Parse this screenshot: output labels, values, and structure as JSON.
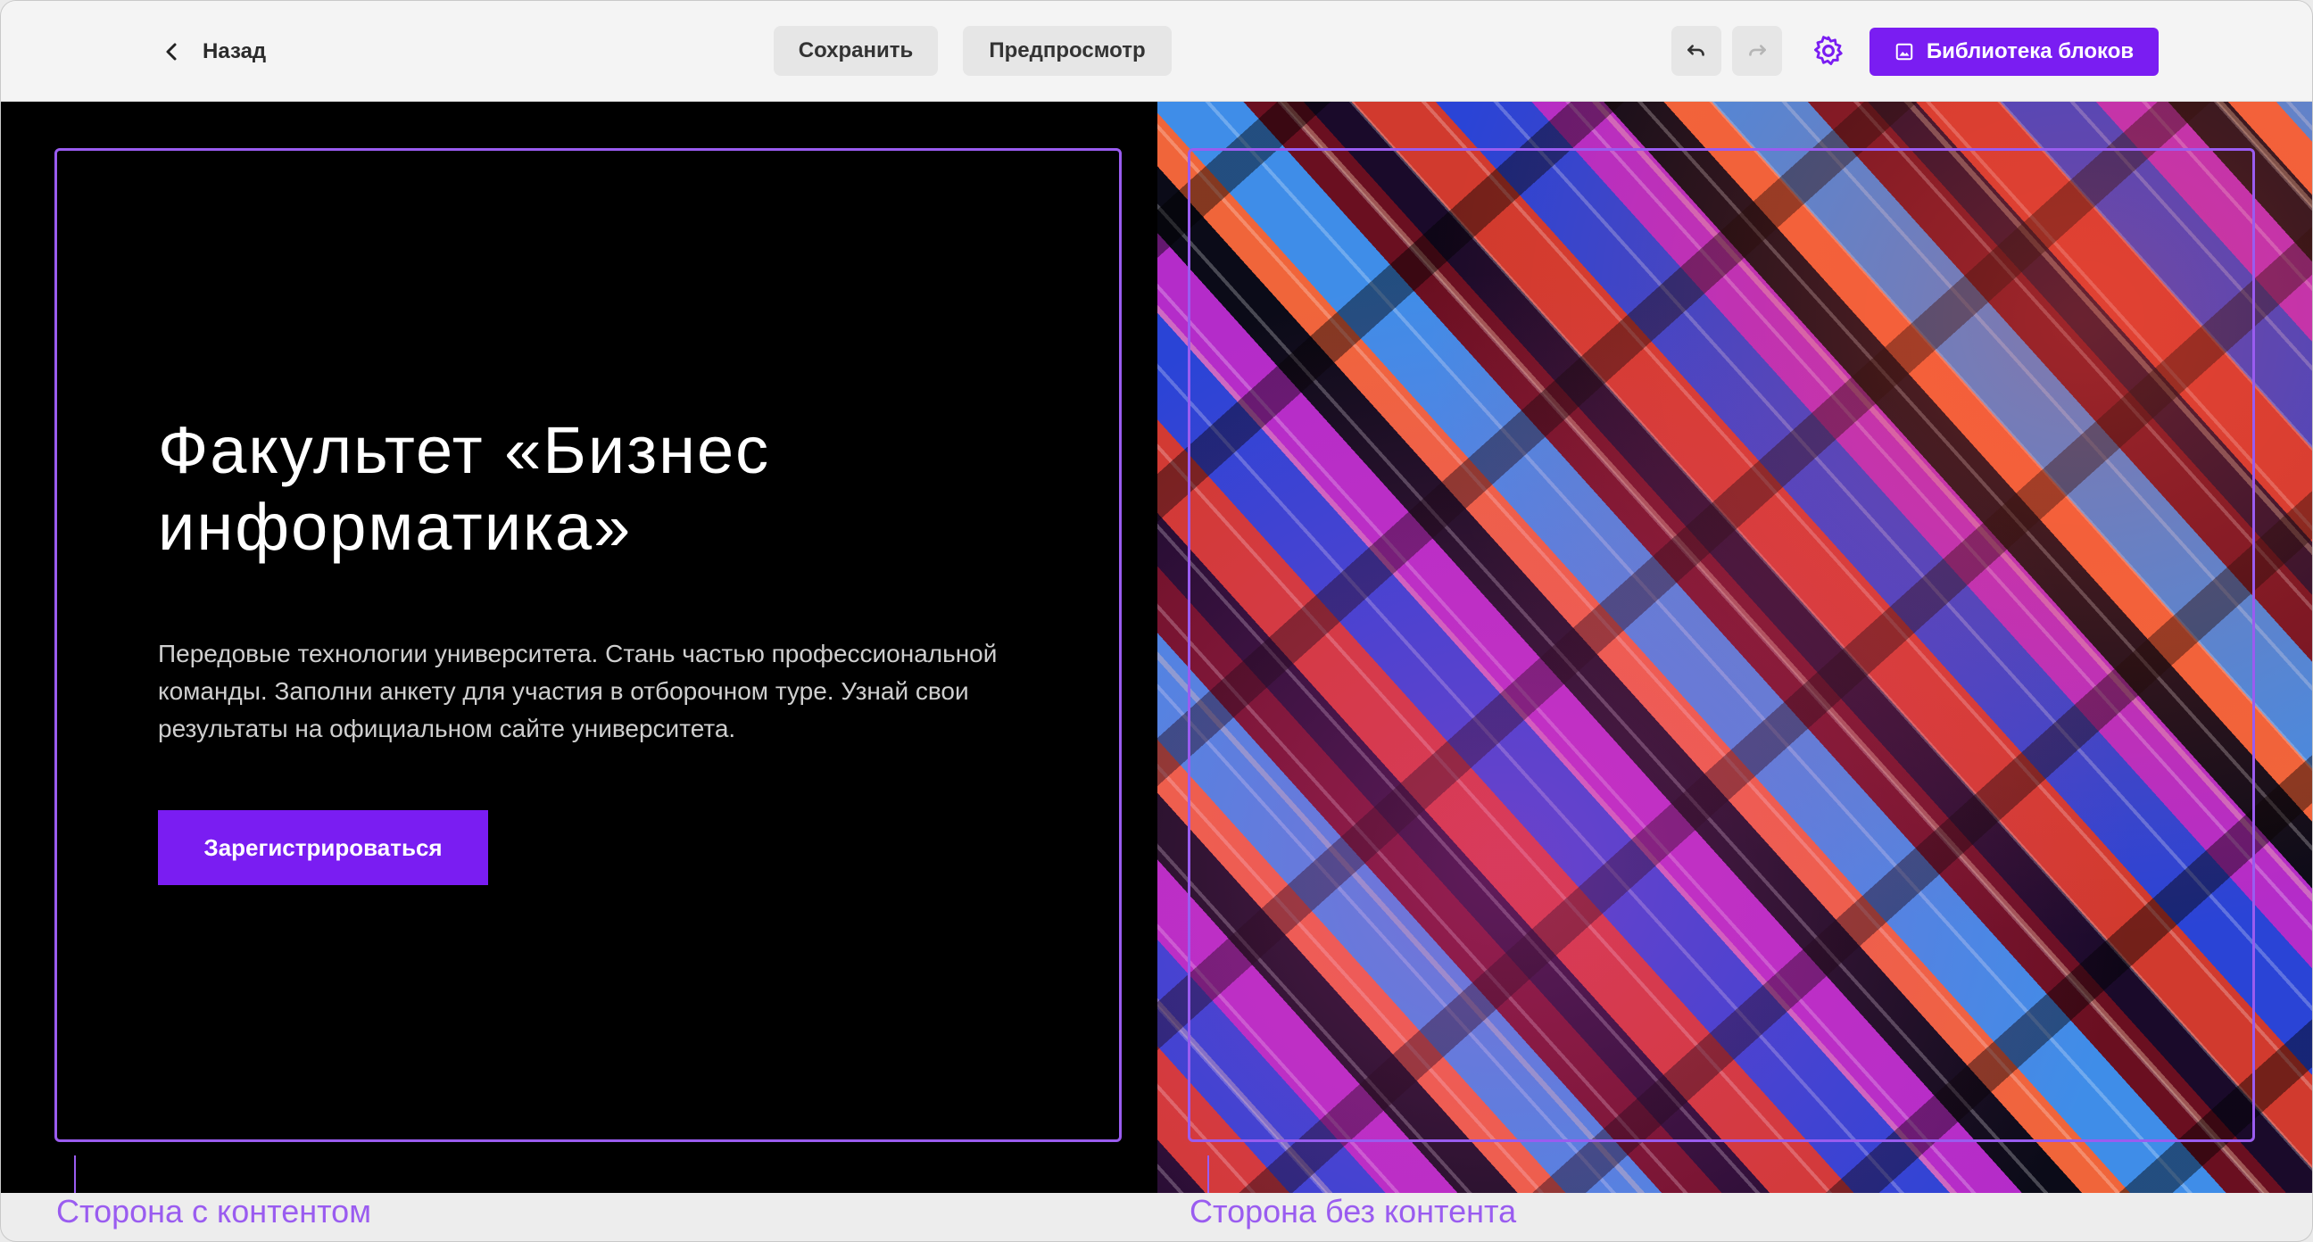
{
  "toolbar": {
    "back_label": "Назад",
    "save_label": "Сохранить",
    "preview_label": "Предпросмотр",
    "library_label": "Библиотека блоков",
    "icons": {
      "back": "chevron-left-icon",
      "undo": "undo-icon",
      "redo": "redo-icon",
      "settings": "gear-icon",
      "library": "image-icon"
    }
  },
  "hero": {
    "title": "Факультет «Бизнес информатика»",
    "description": "Передовые технологии университета. Стань частью профессиональной команды. Заполни анкету для участия в отборочном туре. Узнай свои результаты на официальном сайте университета.",
    "cta_label": "Зарегистрироваться"
  },
  "annotations": {
    "content_side": "Сторона с контентом",
    "image_side": "Сторона без контента"
  },
  "colors": {
    "accent": "#7a1df2",
    "outline": "#9a5cf0",
    "toolbar_bg": "#f4f4f4",
    "content_bg": "#000000"
  }
}
